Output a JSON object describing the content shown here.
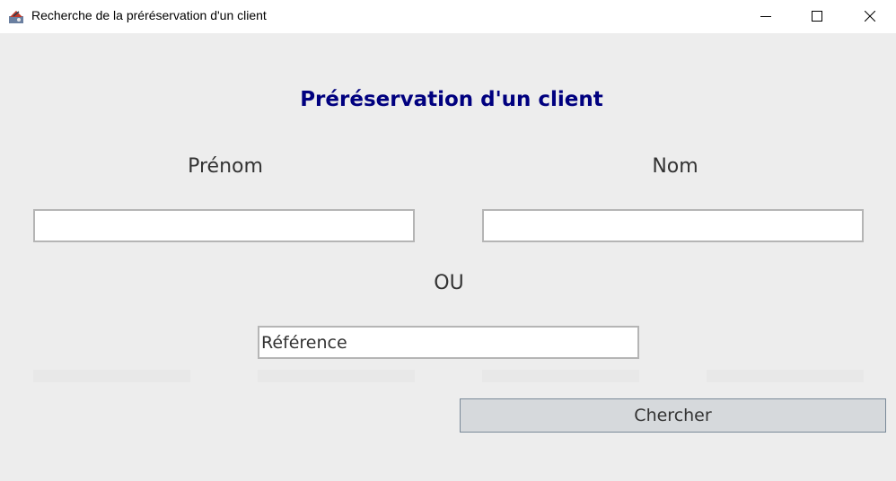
{
  "window": {
    "title": "Recherche de la préréservation d'un client",
    "app_icon": "java-app-icon",
    "controls": [
      "minimize-icon",
      "maximize-icon",
      "close-icon"
    ]
  },
  "form": {
    "heading": "Préréservation d'un client",
    "first_name_label": "Prénom",
    "last_name_label": "Nom",
    "first_name_value": "",
    "last_name_value": "",
    "separator": "OU",
    "reference_value": "Référence",
    "search_button": "Chercher"
  },
  "colors": {
    "heading": "#00007f",
    "background": "#ededed",
    "button": "#d6d9dc"
  }
}
